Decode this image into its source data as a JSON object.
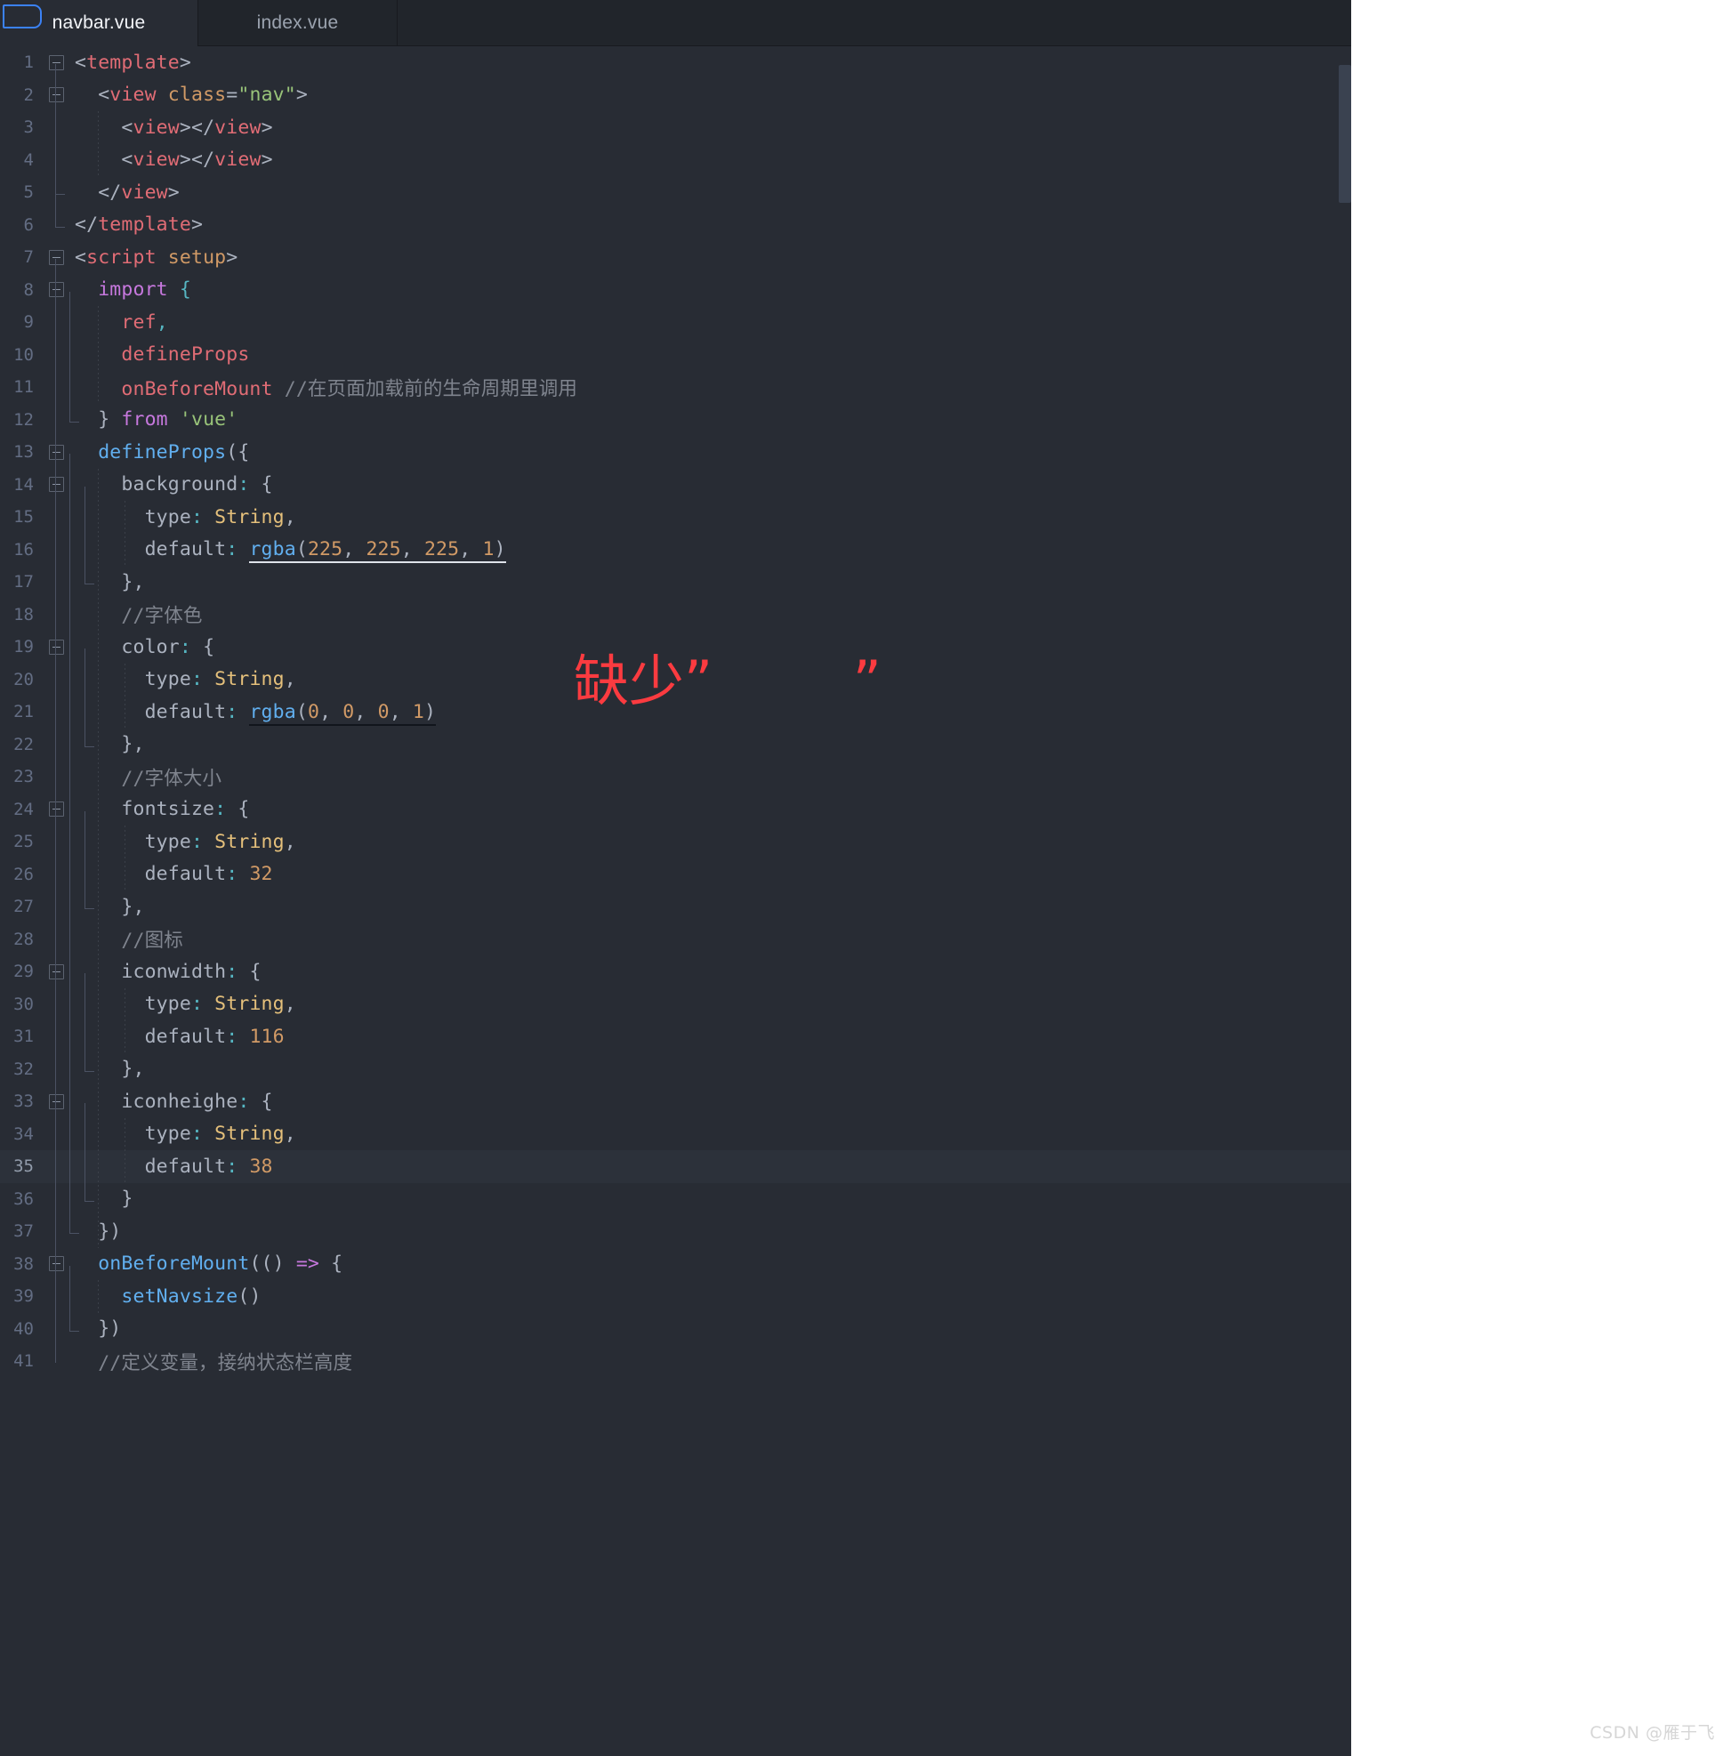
{
  "window": {
    "app": "code-editor",
    "theme_background": "#282c34",
    "tabbar_background": "#21252b",
    "accent": "#61afef",
    "annotation_color": "#fb3b40"
  },
  "tabs": [
    {
      "label": "navbar.vue",
      "active": true
    },
    {
      "label": "index.vue",
      "active": false
    }
  ],
  "annotation": {
    "text": "缺少”        ”"
  },
  "watermark": {
    "text": "CSDN @雁于飞"
  },
  "editor": {
    "current_line": 35,
    "lines": [
      {
        "n": "1",
        "fold": true,
        "tokens": [
          {
            "t": "<",
            "c": "t-punc"
          },
          {
            "t": "template",
            "c": "t-tag"
          },
          {
            "t": ">",
            "c": "t-punc"
          }
        ],
        "indent": ""
      },
      {
        "n": "2",
        "fold": true,
        "tokens": [
          {
            "t": "  <",
            "c": "t-punc"
          },
          {
            "t": "view",
            "c": "t-tag"
          },
          {
            "t": " ",
            "c": "t-punc"
          },
          {
            "t": "class",
            "c": "t-attr"
          },
          {
            "t": "=",
            "c": "t-punc"
          },
          {
            "t": "\"nav\"",
            "c": "t-str"
          },
          {
            "t": ">",
            "c": "t-punc"
          }
        ]
      },
      {
        "n": "3",
        "fold": false,
        "tokens": [
          {
            "t": "    <",
            "c": "t-punc"
          },
          {
            "t": "view",
            "c": "t-tag"
          },
          {
            "t": "></",
            "c": "t-punc"
          },
          {
            "t": "view",
            "c": "t-tag"
          },
          {
            "t": ">",
            "c": "t-punc"
          }
        ]
      },
      {
        "n": "4",
        "fold": false,
        "tokens": [
          {
            "t": "    <",
            "c": "t-punc"
          },
          {
            "t": "view",
            "c": "t-tag"
          },
          {
            "t": "></",
            "c": "t-punc"
          },
          {
            "t": "view",
            "c": "t-tag"
          },
          {
            "t": ">",
            "c": "t-punc"
          }
        ]
      },
      {
        "n": "5",
        "fold": false,
        "tokens": [
          {
            "t": "  </",
            "c": "t-punc"
          },
          {
            "t": "view",
            "c": "t-tag"
          },
          {
            "t": ">",
            "c": "t-punc"
          }
        ]
      },
      {
        "n": "6",
        "fold": false,
        "tokens": [
          {
            "t": "</",
            "c": "t-punc"
          },
          {
            "t": "template",
            "c": "t-tag"
          },
          {
            "t": ">",
            "c": "t-punc"
          }
        ]
      },
      {
        "n": "7",
        "fold": true,
        "tokens": [
          {
            "t": "<",
            "c": "t-punc"
          },
          {
            "t": "script",
            "c": "t-tag"
          },
          {
            "t": " ",
            "c": "t-punc"
          },
          {
            "t": "setup",
            "c": "t-attr"
          },
          {
            "t": ">",
            "c": "t-punc"
          }
        ]
      },
      {
        "n": "8",
        "fold": true,
        "tokens": [
          {
            "t": "  ",
            "c": "t-punc"
          },
          {
            "t": "import",
            "c": "t-kw"
          },
          {
            "t": " ",
            "c": "t-punc"
          },
          {
            "t": "{",
            "c": "t-colon"
          }
        ]
      },
      {
        "n": "9",
        "fold": false,
        "tokens": [
          {
            "t": "    ",
            "c": "t-punc"
          },
          {
            "t": "ref",
            "c": "t-var"
          },
          {
            "t": ",",
            "c": "t-colon"
          }
        ]
      },
      {
        "n": "10",
        "fold": false,
        "tokens": [
          {
            "t": "    ",
            "c": "t-punc"
          },
          {
            "t": "defineProps",
            "c": "t-var"
          }
        ]
      },
      {
        "n": "11",
        "fold": false,
        "tokens": [
          {
            "t": "    ",
            "c": "t-punc"
          },
          {
            "t": "onBeforeMount",
            "c": "t-var"
          },
          {
            "t": " ",
            "c": "t-punc"
          },
          {
            "t": "//在页面加载前的生命周期里调用",
            "c": "t-com"
          }
        ]
      },
      {
        "n": "12",
        "fold": false,
        "tokens": [
          {
            "t": "  } ",
            "c": "t-punc"
          },
          {
            "t": "from",
            "c": "t-kw"
          },
          {
            "t": " ",
            "c": "t-punc"
          },
          {
            "t": "'vue'",
            "c": "t-str"
          }
        ]
      },
      {
        "n": "13",
        "fold": true,
        "tokens": [
          {
            "t": "  ",
            "c": "t-punc"
          },
          {
            "t": "defineProps",
            "c": "t-fn"
          },
          {
            "t": "({",
            "c": "t-punc"
          }
        ]
      },
      {
        "n": "14",
        "fold": true,
        "tokens": [
          {
            "t": "    ",
            "c": "t-punc"
          },
          {
            "t": "background",
            "c": "t-prop"
          },
          {
            "t": ": ",
            "c": "t-colon"
          },
          {
            "t": "{",
            "c": "t-punc"
          }
        ]
      },
      {
        "n": "15",
        "fold": false,
        "tokens": [
          {
            "t": "      ",
            "c": "t-punc"
          },
          {
            "t": "type",
            "c": "t-prop"
          },
          {
            "t": ": ",
            "c": "t-colon"
          },
          {
            "t": "String",
            "c": "t-type"
          },
          {
            "t": ",",
            "c": "t-punc"
          }
        ]
      },
      {
        "n": "16",
        "fold": false,
        "tokens": [
          {
            "t": "      ",
            "c": "t-punc"
          },
          {
            "t": "default",
            "c": "t-prop"
          },
          {
            "t": ": ",
            "c": "t-colon"
          },
          {
            "t": "rgba",
            "c": "t-fn",
            "u": "w"
          },
          {
            "t": "(",
            "c": "t-punc",
            "u": "w"
          },
          {
            "t": "225",
            "c": "t-num",
            "u": "w"
          },
          {
            "t": ", ",
            "c": "t-punc",
            "u": "w"
          },
          {
            "t": "225",
            "c": "t-num",
            "u": "w"
          },
          {
            "t": ", ",
            "c": "t-punc",
            "u": "w"
          },
          {
            "t": "225",
            "c": "t-num",
            "u": "w"
          },
          {
            "t": ", ",
            "c": "t-punc",
            "u": "w"
          },
          {
            "t": "1",
            "c": "t-num",
            "u": "w"
          },
          {
            "t": ")",
            "c": "t-punc",
            "u": "w"
          }
        ]
      },
      {
        "n": "17",
        "fold": false,
        "tokens": [
          {
            "t": "    },",
            "c": "t-punc"
          }
        ]
      },
      {
        "n": "18",
        "fold": false,
        "tokens": [
          {
            "t": "    ",
            "c": "t-punc"
          },
          {
            "t": "//字体色",
            "c": "t-com"
          }
        ]
      },
      {
        "n": "19",
        "fold": true,
        "tokens": [
          {
            "t": "    ",
            "c": "t-punc"
          },
          {
            "t": "color",
            "c": "t-prop"
          },
          {
            "t": ": ",
            "c": "t-colon"
          },
          {
            "t": "{",
            "c": "t-punc"
          }
        ]
      },
      {
        "n": "20",
        "fold": false,
        "tokens": [
          {
            "t": "      ",
            "c": "t-punc"
          },
          {
            "t": "type",
            "c": "t-prop"
          },
          {
            "t": ": ",
            "c": "t-colon"
          },
          {
            "t": "String",
            "c": "t-type"
          },
          {
            "t": ",",
            "c": "t-punc"
          }
        ]
      },
      {
        "n": "21",
        "fold": false,
        "tokens": [
          {
            "t": "      ",
            "c": "t-punc"
          },
          {
            "t": "default",
            "c": "t-prop"
          },
          {
            "t": ": ",
            "c": "t-colon"
          },
          {
            "t": "rgba",
            "c": "t-fn",
            "u": "b"
          },
          {
            "t": "(",
            "c": "t-punc",
            "u": "b"
          },
          {
            "t": "0",
            "c": "t-num",
            "u": "b"
          },
          {
            "t": ", ",
            "c": "t-punc",
            "u": "b"
          },
          {
            "t": "0",
            "c": "t-num",
            "u": "b"
          },
          {
            "t": ", ",
            "c": "t-punc",
            "u": "b"
          },
          {
            "t": "0",
            "c": "t-num",
            "u": "b"
          },
          {
            "t": ", ",
            "c": "t-punc",
            "u": "b"
          },
          {
            "t": "1",
            "c": "t-num",
            "u": "b"
          },
          {
            "t": ")",
            "c": "t-punc",
            "u": "b"
          }
        ]
      },
      {
        "n": "22",
        "fold": false,
        "tokens": [
          {
            "t": "    },",
            "c": "t-punc"
          }
        ]
      },
      {
        "n": "23",
        "fold": false,
        "tokens": [
          {
            "t": "    ",
            "c": "t-punc"
          },
          {
            "t": "//字体大小",
            "c": "t-com"
          }
        ]
      },
      {
        "n": "24",
        "fold": true,
        "tokens": [
          {
            "t": "    ",
            "c": "t-punc"
          },
          {
            "t": "fontsize",
            "c": "t-prop"
          },
          {
            "t": ": ",
            "c": "t-colon"
          },
          {
            "t": "{",
            "c": "t-punc"
          }
        ]
      },
      {
        "n": "25",
        "fold": false,
        "tokens": [
          {
            "t": "      ",
            "c": "t-punc"
          },
          {
            "t": "type",
            "c": "t-prop"
          },
          {
            "t": ": ",
            "c": "t-colon"
          },
          {
            "t": "String",
            "c": "t-type"
          },
          {
            "t": ",",
            "c": "t-punc"
          }
        ]
      },
      {
        "n": "26",
        "fold": false,
        "tokens": [
          {
            "t": "      ",
            "c": "t-punc"
          },
          {
            "t": "default",
            "c": "t-prop"
          },
          {
            "t": ": ",
            "c": "t-colon"
          },
          {
            "t": "32",
            "c": "t-num"
          }
        ]
      },
      {
        "n": "27",
        "fold": false,
        "tokens": [
          {
            "t": "    },",
            "c": "t-punc"
          }
        ]
      },
      {
        "n": "28",
        "fold": false,
        "tokens": [
          {
            "t": "    ",
            "c": "t-punc"
          },
          {
            "t": "//图标",
            "c": "t-com"
          }
        ]
      },
      {
        "n": "29",
        "fold": true,
        "tokens": [
          {
            "t": "    ",
            "c": "t-punc"
          },
          {
            "t": "iconwidth",
            "c": "t-prop"
          },
          {
            "t": ": ",
            "c": "t-colon"
          },
          {
            "t": "{",
            "c": "t-punc"
          }
        ]
      },
      {
        "n": "30",
        "fold": false,
        "tokens": [
          {
            "t": "      ",
            "c": "t-punc"
          },
          {
            "t": "type",
            "c": "t-prop"
          },
          {
            "t": ": ",
            "c": "t-colon"
          },
          {
            "t": "String",
            "c": "t-type"
          },
          {
            "t": ",",
            "c": "t-punc"
          }
        ]
      },
      {
        "n": "31",
        "fold": false,
        "tokens": [
          {
            "t": "      ",
            "c": "t-punc"
          },
          {
            "t": "default",
            "c": "t-prop"
          },
          {
            "t": ": ",
            "c": "t-colon"
          },
          {
            "t": "116",
            "c": "t-num"
          }
        ]
      },
      {
        "n": "32",
        "fold": false,
        "tokens": [
          {
            "t": "    },",
            "c": "t-punc"
          }
        ]
      },
      {
        "n": "33",
        "fold": true,
        "tokens": [
          {
            "t": "    ",
            "c": "t-punc"
          },
          {
            "t": "iconheighe",
            "c": "t-prop"
          },
          {
            "t": ": ",
            "c": "t-colon"
          },
          {
            "t": "{",
            "c": "t-punc"
          }
        ]
      },
      {
        "n": "34",
        "fold": false,
        "tokens": [
          {
            "t": "      ",
            "c": "t-punc"
          },
          {
            "t": "type",
            "c": "t-prop"
          },
          {
            "t": ": ",
            "c": "t-colon"
          },
          {
            "t": "String",
            "c": "t-type"
          },
          {
            "t": ",",
            "c": "t-punc"
          }
        ]
      },
      {
        "n": "35",
        "fold": false,
        "cur": true,
        "tokens": [
          {
            "t": "      ",
            "c": "t-punc"
          },
          {
            "t": "default",
            "c": "t-prop"
          },
          {
            "t": ": ",
            "c": "t-colon"
          },
          {
            "t": "38",
            "c": "t-num"
          }
        ]
      },
      {
        "n": "36",
        "fold": false,
        "tokens": [
          {
            "t": "    }",
            "c": "t-punc"
          }
        ]
      },
      {
        "n": "37",
        "fold": false,
        "tokens": [
          {
            "t": "  })",
            "c": "t-punc"
          }
        ]
      },
      {
        "n": "38",
        "fold": true,
        "tokens": [
          {
            "t": "  ",
            "c": "t-punc"
          },
          {
            "t": "onBeforeMount",
            "c": "t-fn"
          },
          {
            "t": "(() ",
            "c": "t-punc"
          },
          {
            "t": "=>",
            "c": "t-op"
          },
          {
            "t": " {",
            "c": "t-punc"
          }
        ]
      },
      {
        "n": "39",
        "fold": false,
        "tokens": [
          {
            "t": "    ",
            "c": "t-punc"
          },
          {
            "t": "setNavsize",
            "c": "t-fn"
          },
          {
            "t": "()",
            "c": "t-punc"
          }
        ]
      },
      {
        "n": "40",
        "fold": false,
        "tokens": [
          {
            "t": "  })",
            "c": "t-punc"
          }
        ]
      },
      {
        "n": "41",
        "fold": false,
        "tokens": [
          {
            "t": "  ",
            "c": "t-punc"
          },
          {
            "t": "//定义变量，接纳状态栏高度",
            "c": "t-com"
          }
        ]
      }
    ]
  }
}
